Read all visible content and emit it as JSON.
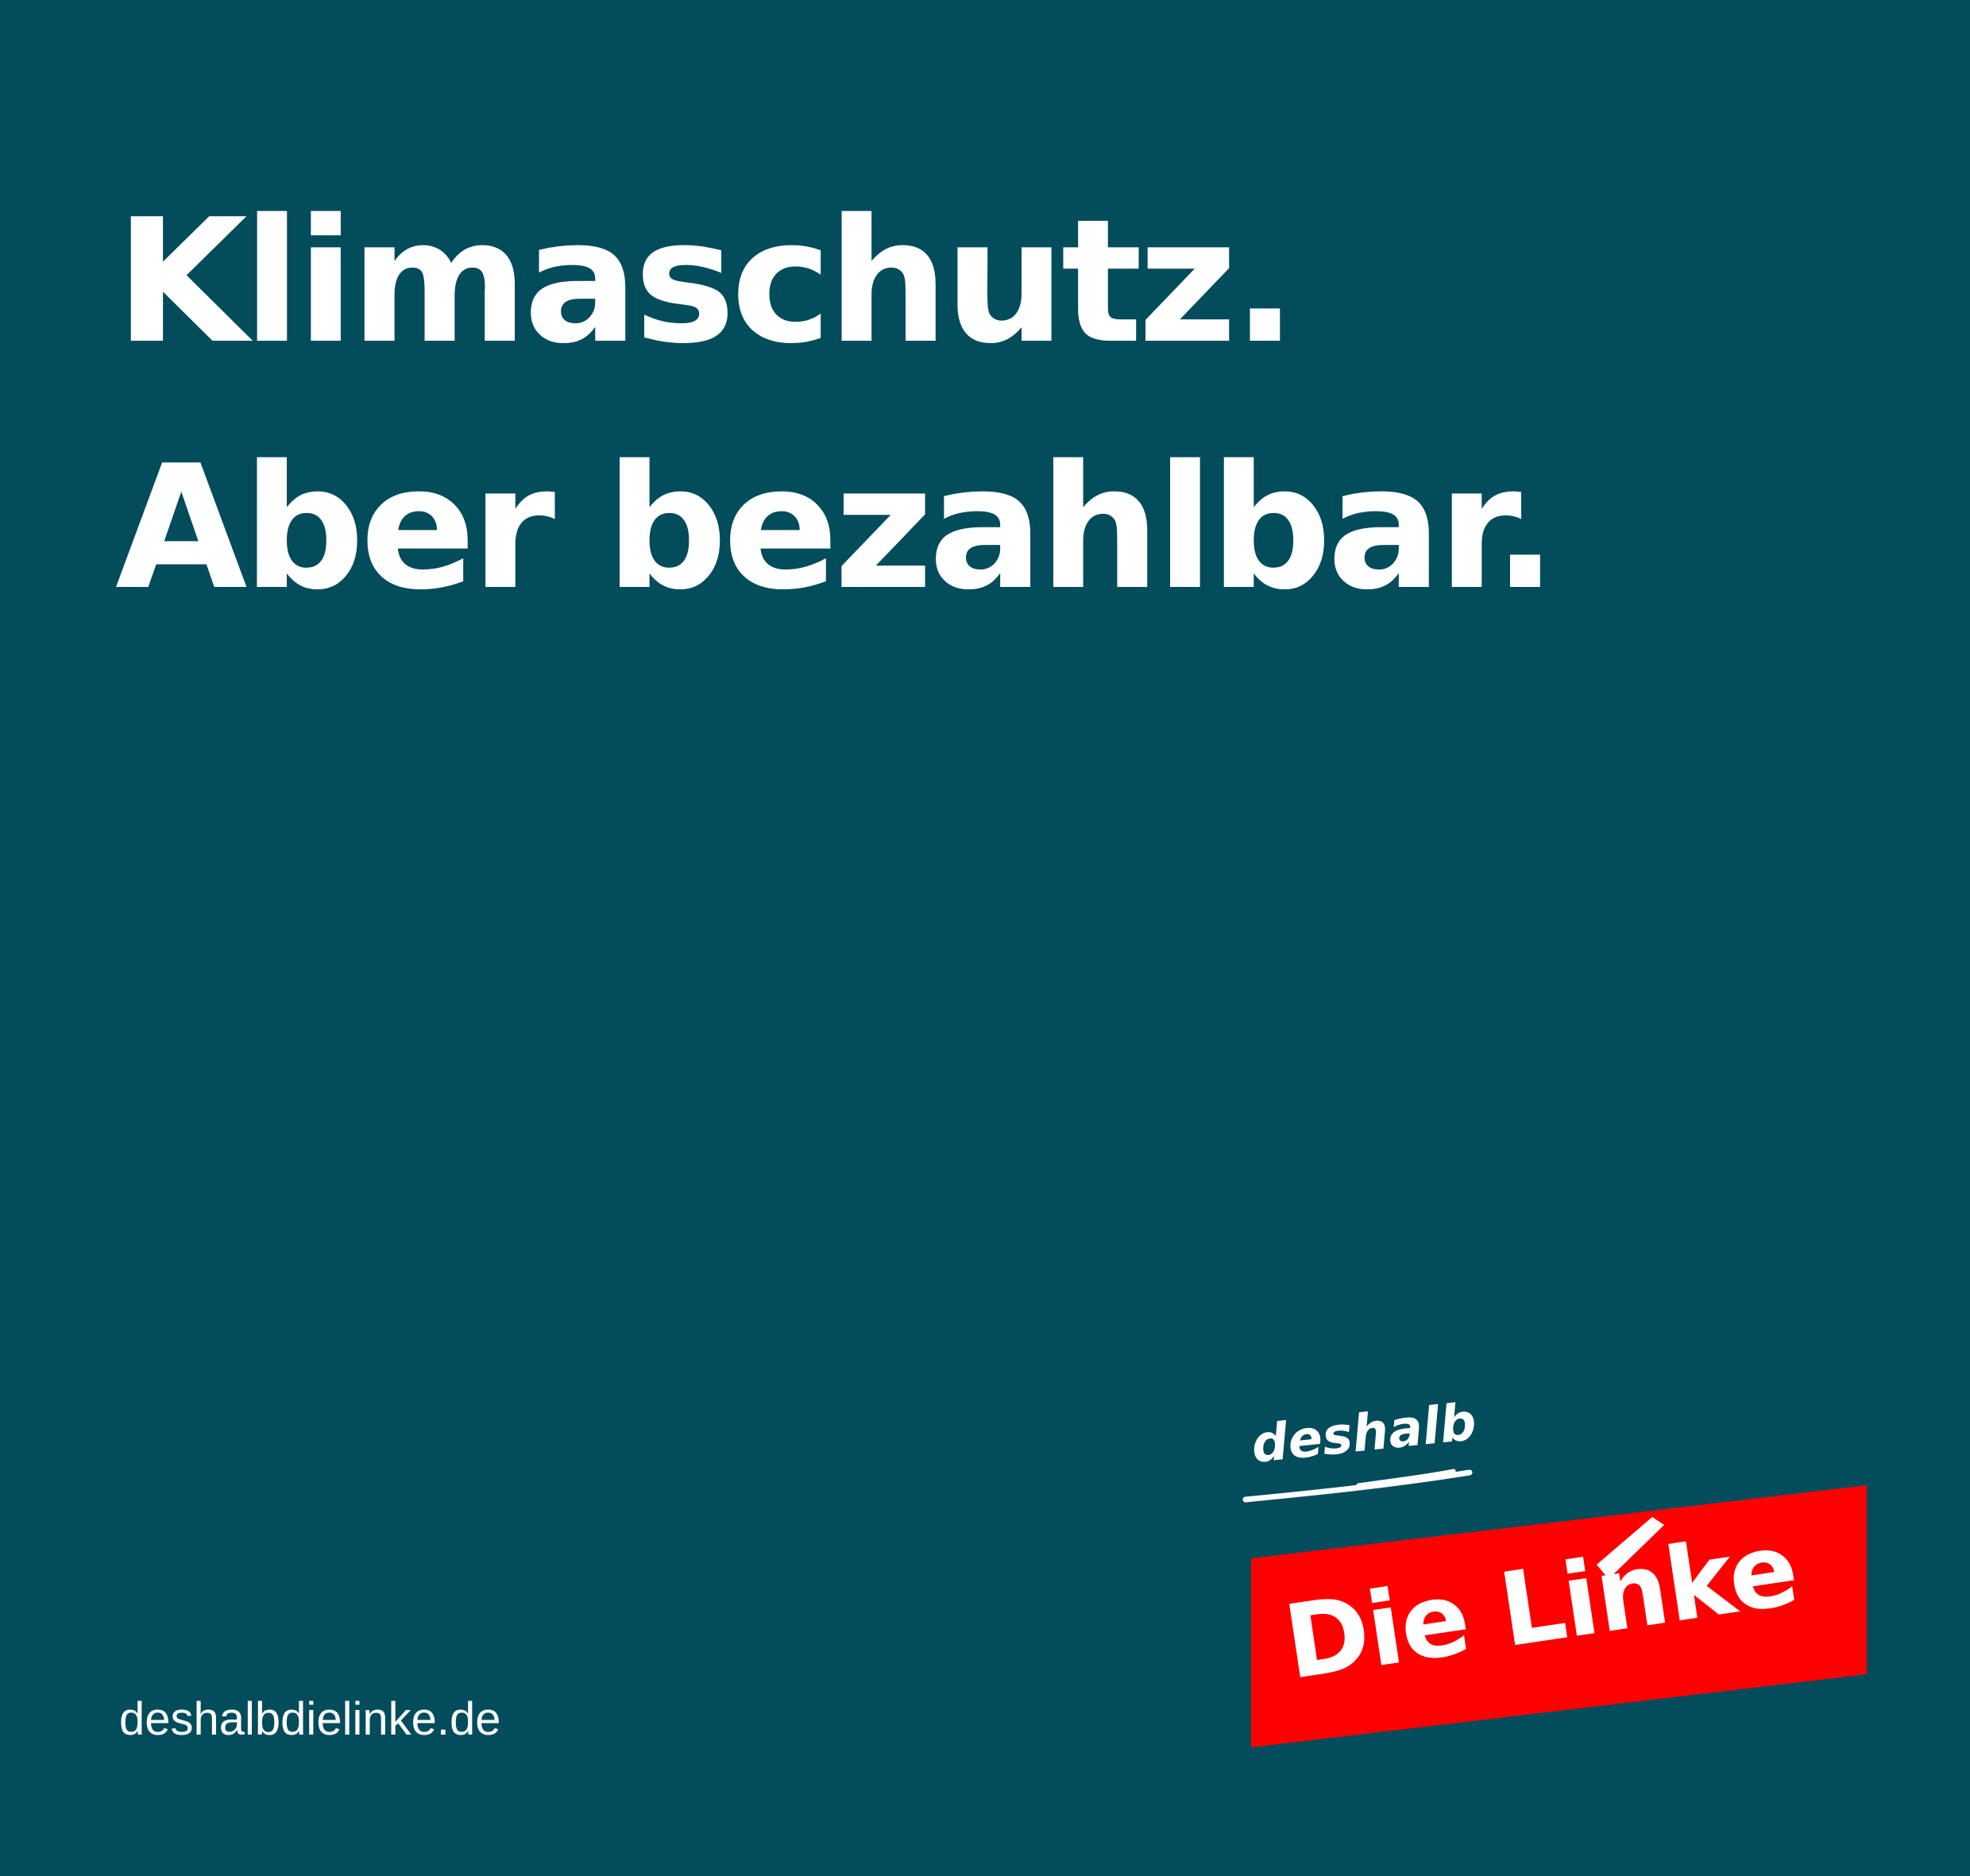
{
  "poster": {
    "headline": {
      "line1": "Klimaschutz.",
      "line2": "Aber bezahlbar."
    },
    "website": "deshalbdielinke.de",
    "logo": {
      "tagline": "deshalb",
      "brand": "Die Linke",
      "band_color": "#ff0000",
      "text_color": "#ffffff"
    },
    "colors": {
      "background": "#034c5c",
      "text": "#ffffff",
      "accent": "#ff0000"
    }
  }
}
